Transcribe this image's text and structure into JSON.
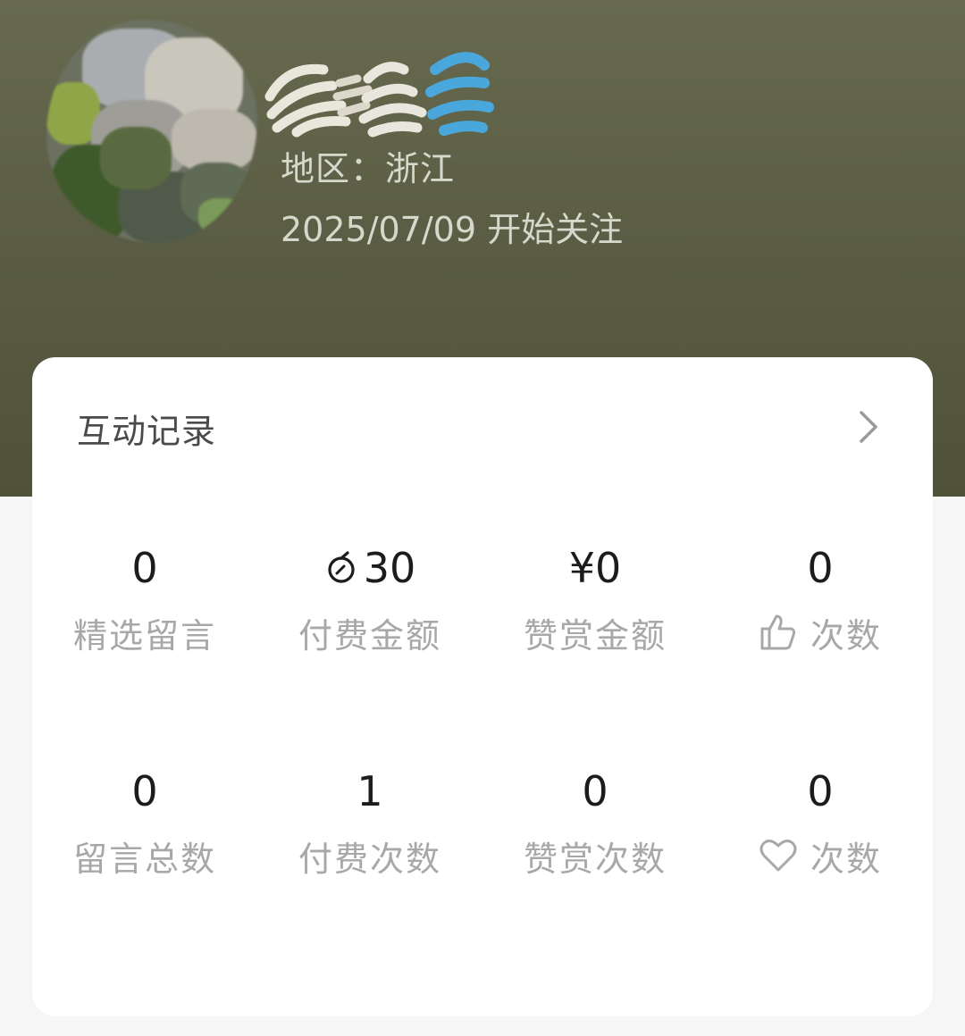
{
  "profile": {
    "avatar_icon": "blurred-avatar",
    "nickname_icon": "obscured-nickname",
    "region_label": "地区：",
    "region_value": "浙江",
    "follow_date": "2025/07/09",
    "follow_suffix": "开始关注"
  },
  "interaction": {
    "title": "互动记录",
    "chevron_icon": "chevron-right-icon",
    "stats": [
      {
        "value": "0",
        "label": "精选留言"
      },
      {
        "value_icon": "coin-icon",
        "value": "30",
        "label": "付费金额"
      },
      {
        "value": "¥0",
        "label": "赞赏金额"
      },
      {
        "value": "0",
        "label_icon": "thumbs-up-icon",
        "label": "次数"
      },
      {
        "value": "0",
        "label": "留言总数"
      },
      {
        "value": "1",
        "label": "付费次数"
      },
      {
        "value": "0",
        "label": "赞赏次数"
      },
      {
        "value": "0",
        "label_icon": "heart-icon",
        "label": "次数"
      }
    ]
  },
  "colors": {
    "header_bg": "#5e6147",
    "card_bg": "#ffffff",
    "value_text": "#1c1c1c",
    "label_text": "#a8a8a8",
    "meta_text": "#d7d8cc"
  }
}
